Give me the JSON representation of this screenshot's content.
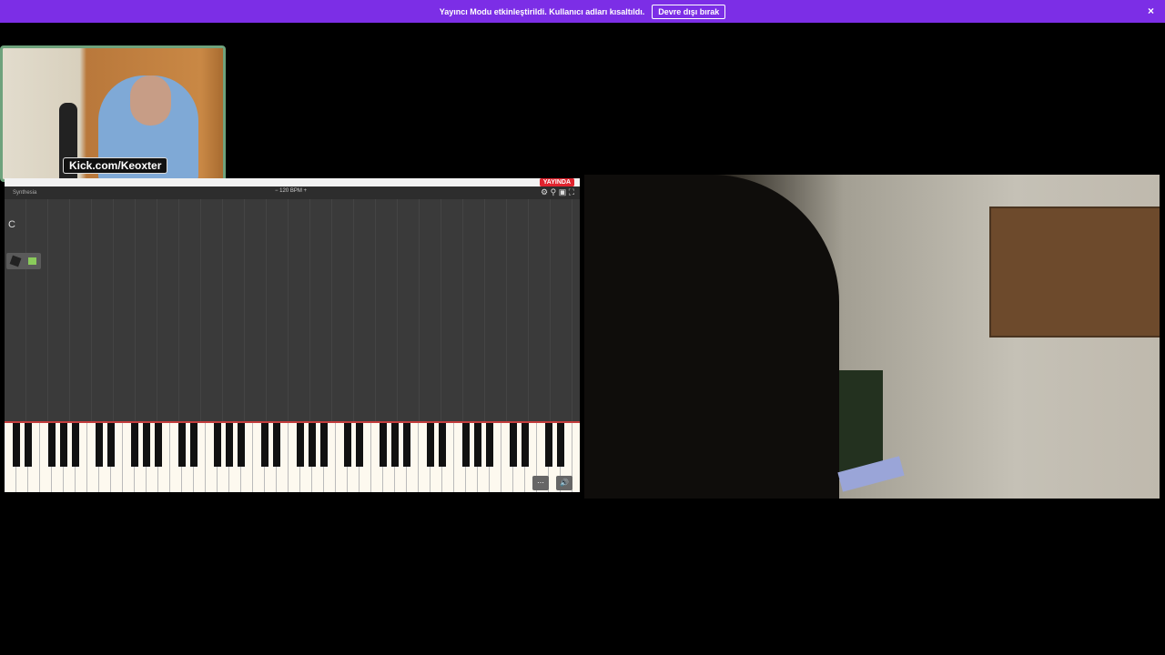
{
  "banner": {
    "message": "Yayıncı Modu etkinleştirildi. Kullanıcı adları kısaltıldı.",
    "disable_button": "Devre dışı bırak",
    "close_icon": "×"
  },
  "webcam": {
    "handle": "Kick.com/Keoxter"
  },
  "synthesia": {
    "app_name": "Synthesia",
    "bpm_label": "− 120 BPM +",
    "live_badge": "YAYINDA",
    "clef_label": "C",
    "toolbar_icons": "⚙ ⚲ ▣ ⛶",
    "more_icon": "⋯",
    "volume_icon": "🔊"
  }
}
